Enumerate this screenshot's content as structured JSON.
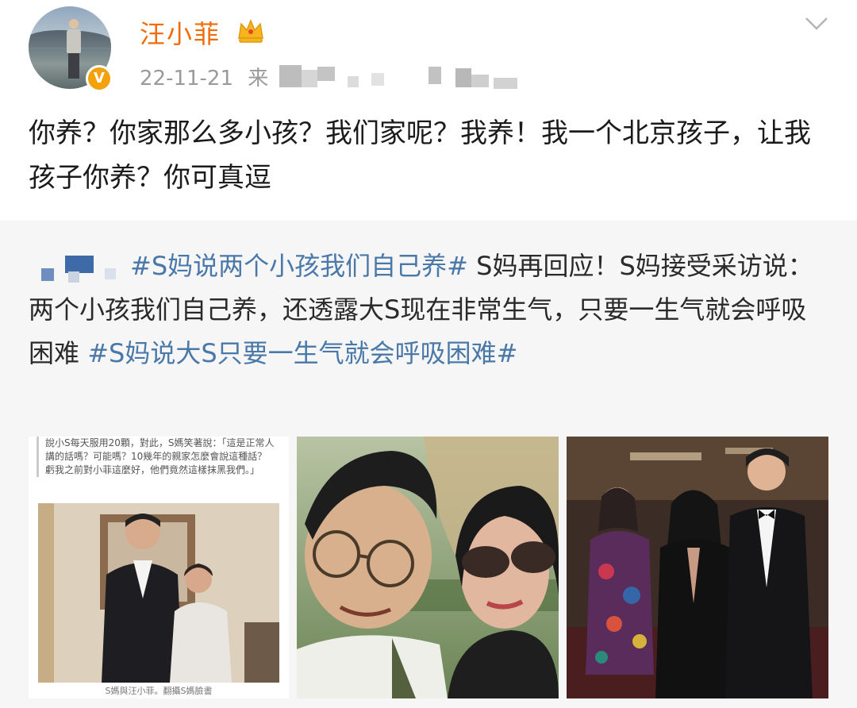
{
  "post": {
    "username": "汪小菲",
    "date": "22-11-21",
    "source_prefix": "来",
    "text": "你养？你家那么多小孩？我们家呢？我养！我一个北京孩子，让我孩子你养？你可真逗"
  },
  "repost": {
    "tag1": "#S妈说两个小孩我们自己养#",
    "text1": " S妈再回应！S妈接受采访说：两个小孩我们自己养，还透露大S现在非常生气，只要一生气就会呼吸困难 ",
    "tag2": "#S妈说大S只要一生气就会呼吸困难#"
  },
  "images": {
    "news_text": "說小S每天服用20顆，對此，S媽笑著說：「這是正常人講的話嗎？可能嗎？10幾年的親家怎麼會說這種話？虧我之前對小菲這麼好，他們竟然這樣抹黑我們。」",
    "news_caption": "S媽與汪小菲。翻攝S媽臉書"
  },
  "colors": {
    "username": "#f06b0a",
    "hashtag": "#4a78a8",
    "verified_badge": "#f4a20c"
  },
  "icons": [
    "crown-icon",
    "verified-badge-icon",
    "chevron-down-icon"
  ]
}
